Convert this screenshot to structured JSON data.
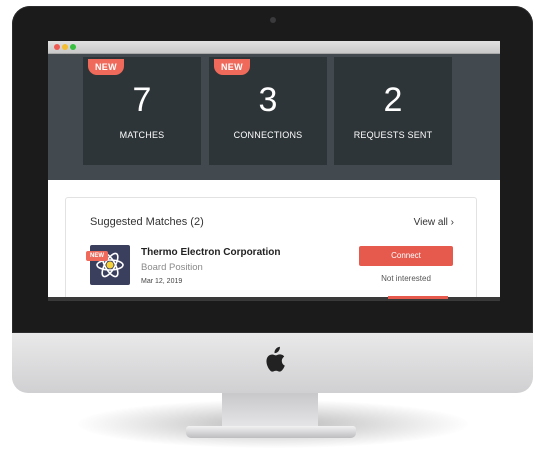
{
  "window": {
    "controls": [
      "close",
      "minimize",
      "zoom"
    ]
  },
  "stats": [
    {
      "badge": "NEW",
      "number": "7",
      "label": "MATCHES"
    },
    {
      "badge": "NEW",
      "number": "3",
      "label": "CONNECTIONS"
    },
    {
      "badge": "",
      "number": "2",
      "label": "REQUESTS SENT"
    }
  ],
  "suggested": {
    "title": "Suggested Matches (2)",
    "view_all": "View all ›",
    "items": [
      {
        "badge": "NEW",
        "company": "Thermo Electron Corporation",
        "position": "Board Position",
        "date": "Mar 12, 2019",
        "connect_label": "Connect",
        "not_interested_label": "Not interested",
        "logo_icon": "atom-icon"
      }
    ]
  },
  "colors": {
    "accent": "#e65a4d",
    "badge": "#ef6a5b",
    "header_bg": "#424a4f",
    "card_bg": "#2e3538"
  }
}
